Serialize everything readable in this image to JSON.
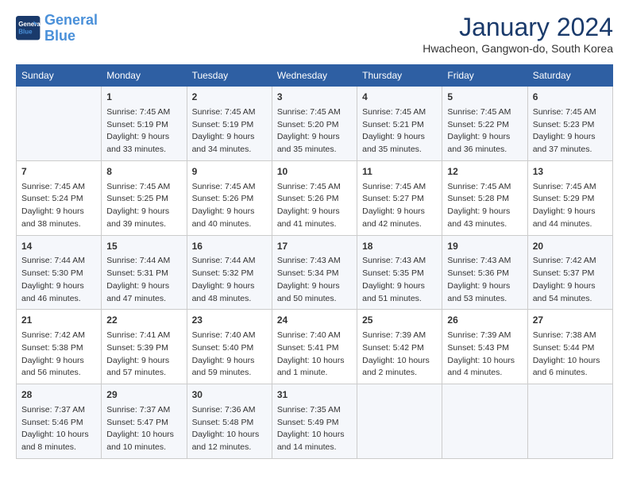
{
  "logo": {
    "line1": "General",
    "line2": "Blue"
  },
  "title": "January 2024",
  "location": "Hwacheon, Gangwon-do, South Korea",
  "days_of_week": [
    "Sunday",
    "Monday",
    "Tuesday",
    "Wednesday",
    "Thursday",
    "Friday",
    "Saturday"
  ],
  "weeks": [
    [
      {
        "day": "",
        "info": ""
      },
      {
        "day": "1",
        "info": "Sunrise: 7:45 AM\nSunset: 5:19 PM\nDaylight: 9 hours\nand 33 minutes."
      },
      {
        "day": "2",
        "info": "Sunrise: 7:45 AM\nSunset: 5:19 PM\nDaylight: 9 hours\nand 34 minutes."
      },
      {
        "day": "3",
        "info": "Sunrise: 7:45 AM\nSunset: 5:20 PM\nDaylight: 9 hours\nand 35 minutes."
      },
      {
        "day": "4",
        "info": "Sunrise: 7:45 AM\nSunset: 5:21 PM\nDaylight: 9 hours\nand 35 minutes."
      },
      {
        "day": "5",
        "info": "Sunrise: 7:45 AM\nSunset: 5:22 PM\nDaylight: 9 hours\nand 36 minutes."
      },
      {
        "day": "6",
        "info": "Sunrise: 7:45 AM\nSunset: 5:23 PM\nDaylight: 9 hours\nand 37 minutes."
      }
    ],
    [
      {
        "day": "7",
        "info": "Sunrise: 7:45 AM\nSunset: 5:24 PM\nDaylight: 9 hours\nand 38 minutes."
      },
      {
        "day": "8",
        "info": "Sunrise: 7:45 AM\nSunset: 5:25 PM\nDaylight: 9 hours\nand 39 minutes."
      },
      {
        "day": "9",
        "info": "Sunrise: 7:45 AM\nSunset: 5:26 PM\nDaylight: 9 hours\nand 40 minutes."
      },
      {
        "day": "10",
        "info": "Sunrise: 7:45 AM\nSunset: 5:26 PM\nDaylight: 9 hours\nand 41 minutes."
      },
      {
        "day": "11",
        "info": "Sunrise: 7:45 AM\nSunset: 5:27 PM\nDaylight: 9 hours\nand 42 minutes."
      },
      {
        "day": "12",
        "info": "Sunrise: 7:45 AM\nSunset: 5:28 PM\nDaylight: 9 hours\nand 43 minutes."
      },
      {
        "day": "13",
        "info": "Sunrise: 7:45 AM\nSunset: 5:29 PM\nDaylight: 9 hours\nand 44 minutes."
      }
    ],
    [
      {
        "day": "14",
        "info": "Sunrise: 7:44 AM\nSunset: 5:30 PM\nDaylight: 9 hours\nand 46 minutes."
      },
      {
        "day": "15",
        "info": "Sunrise: 7:44 AM\nSunset: 5:31 PM\nDaylight: 9 hours\nand 47 minutes."
      },
      {
        "day": "16",
        "info": "Sunrise: 7:44 AM\nSunset: 5:32 PM\nDaylight: 9 hours\nand 48 minutes."
      },
      {
        "day": "17",
        "info": "Sunrise: 7:43 AM\nSunset: 5:34 PM\nDaylight: 9 hours\nand 50 minutes."
      },
      {
        "day": "18",
        "info": "Sunrise: 7:43 AM\nSunset: 5:35 PM\nDaylight: 9 hours\nand 51 minutes."
      },
      {
        "day": "19",
        "info": "Sunrise: 7:43 AM\nSunset: 5:36 PM\nDaylight: 9 hours\nand 53 minutes."
      },
      {
        "day": "20",
        "info": "Sunrise: 7:42 AM\nSunset: 5:37 PM\nDaylight: 9 hours\nand 54 minutes."
      }
    ],
    [
      {
        "day": "21",
        "info": "Sunrise: 7:42 AM\nSunset: 5:38 PM\nDaylight: 9 hours\nand 56 minutes."
      },
      {
        "day": "22",
        "info": "Sunrise: 7:41 AM\nSunset: 5:39 PM\nDaylight: 9 hours\nand 57 minutes."
      },
      {
        "day": "23",
        "info": "Sunrise: 7:40 AM\nSunset: 5:40 PM\nDaylight: 9 hours\nand 59 minutes."
      },
      {
        "day": "24",
        "info": "Sunrise: 7:40 AM\nSunset: 5:41 PM\nDaylight: 10 hours\nand 1 minute."
      },
      {
        "day": "25",
        "info": "Sunrise: 7:39 AM\nSunset: 5:42 PM\nDaylight: 10 hours\nand 2 minutes."
      },
      {
        "day": "26",
        "info": "Sunrise: 7:39 AM\nSunset: 5:43 PM\nDaylight: 10 hours\nand 4 minutes."
      },
      {
        "day": "27",
        "info": "Sunrise: 7:38 AM\nSunset: 5:44 PM\nDaylight: 10 hours\nand 6 minutes."
      }
    ],
    [
      {
        "day": "28",
        "info": "Sunrise: 7:37 AM\nSunset: 5:46 PM\nDaylight: 10 hours\nand 8 minutes."
      },
      {
        "day": "29",
        "info": "Sunrise: 7:37 AM\nSunset: 5:47 PM\nDaylight: 10 hours\nand 10 minutes."
      },
      {
        "day": "30",
        "info": "Sunrise: 7:36 AM\nSunset: 5:48 PM\nDaylight: 10 hours\nand 12 minutes."
      },
      {
        "day": "31",
        "info": "Sunrise: 7:35 AM\nSunset: 5:49 PM\nDaylight: 10 hours\nand 14 minutes."
      },
      {
        "day": "",
        "info": ""
      },
      {
        "day": "",
        "info": ""
      },
      {
        "day": "",
        "info": ""
      }
    ]
  ]
}
